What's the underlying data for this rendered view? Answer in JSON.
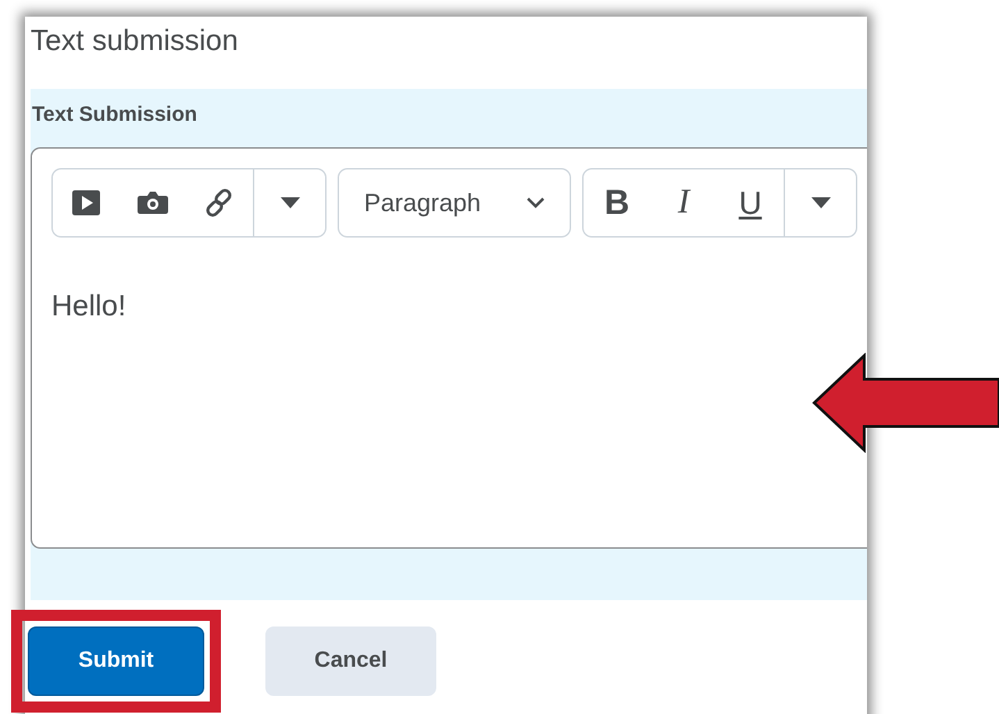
{
  "panel": {
    "title": "Text submission"
  },
  "field": {
    "label": "Text Submission",
    "format": {
      "value": "Paragraph"
    },
    "style_buttons": [
      {
        "text": "B",
        "kind": "bold"
      },
      {
        "text": "I",
        "kind": "italic"
      },
      {
        "text": "U",
        "kind": "underline"
      }
    ],
    "content": "Hello!"
  },
  "buttons": [
    {
      "label": "Submit",
      "kind": "primary",
      "highlighted": true
    },
    {
      "label": "Cancel",
      "kind": "secondary",
      "highlighted": false
    }
  ]
}
